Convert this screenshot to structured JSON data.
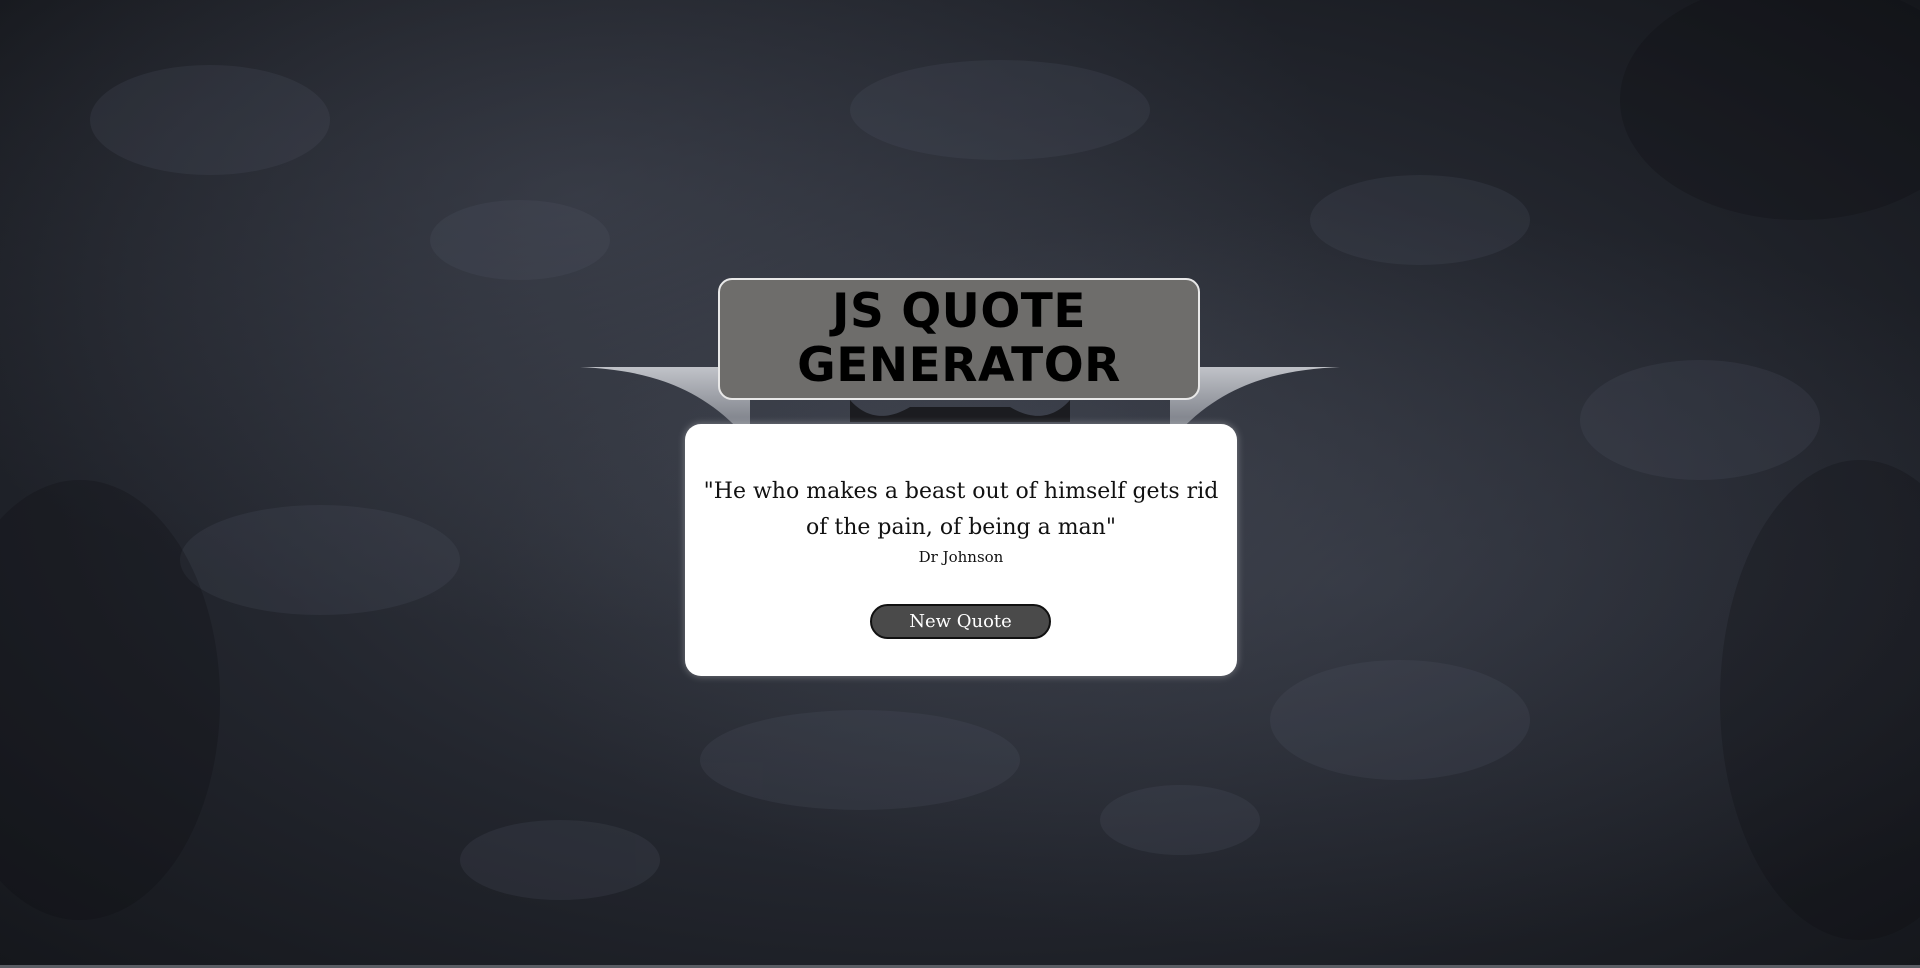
{
  "header": {
    "title_line1": "JS QUOTE",
    "title_line2": "GENERATOR"
  },
  "quote": {
    "text": "\"He who makes a beast out of himself gets rid of the pain, of being a man\"",
    "author": "Dr Johnson"
  },
  "actions": {
    "new_quote_label": "New Quote"
  },
  "colors": {
    "title_box_bg": "#6e6d6b",
    "card_bg": "#ffffff",
    "button_bg": "#4a4a4a"
  },
  "icons": {
    "background_logo": "bat-symbol-icon"
  }
}
